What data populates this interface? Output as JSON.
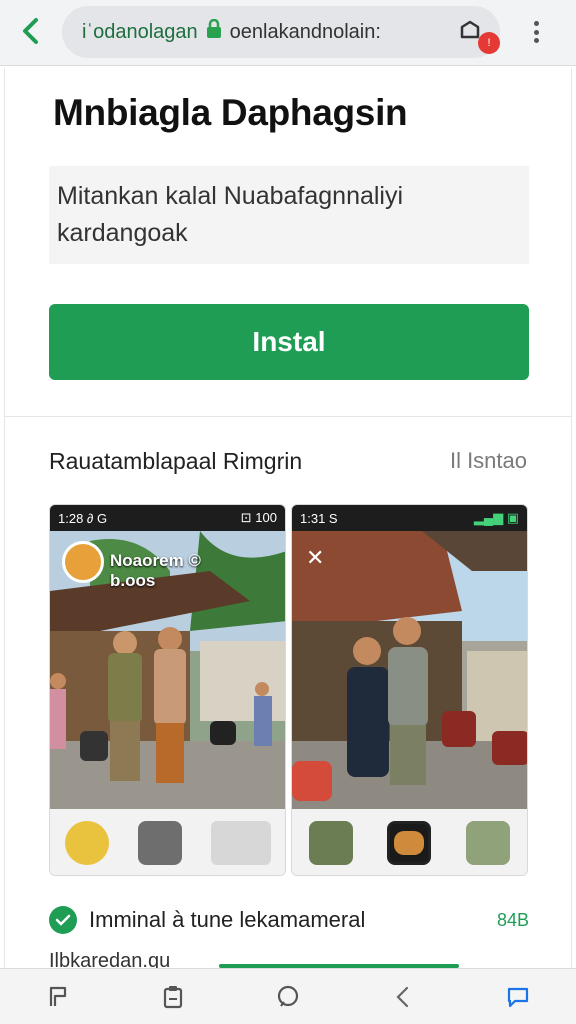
{
  "browser": {
    "url_host": "iˈodanolagan",
    "url_rest": "oenlakandnolain:",
    "tab_badge": "!"
  },
  "app": {
    "title": "Mnbiagla Daphagsin",
    "description": "Mitankan kalal Nuabafagnnaliyi kardangoak",
    "install_label": "Instal"
  },
  "screenshots_section": {
    "title": "Rauatamblapaal Rimgrin",
    "link": "Il Isntao",
    "shots": [
      {
        "status_time": "1:28 ∂ G",
        "status_right": "⊡ 100",
        "overlay_line1": "Noaorem ©",
        "overlay_line2": "b.oos"
      },
      {
        "status_time": "1:31 S",
        "status_right": "▂▄▆ ▣"
      }
    ]
  },
  "info_row": {
    "text": "Imminal à tune lekamameral",
    "size": "84B"
  },
  "cut_row": {
    "text": "Ilbkaredan.qu"
  },
  "colors": {
    "accent": "#1f9d55",
    "badge": "#e53935"
  },
  "icons": [
    "back-arrow-icon",
    "lock-icon",
    "tabs-icon",
    "more-vert-icon",
    "check-icon",
    "bookmark-icon",
    "clipboard-icon",
    "chat-icon",
    "back-icon",
    "message-icon"
  ]
}
